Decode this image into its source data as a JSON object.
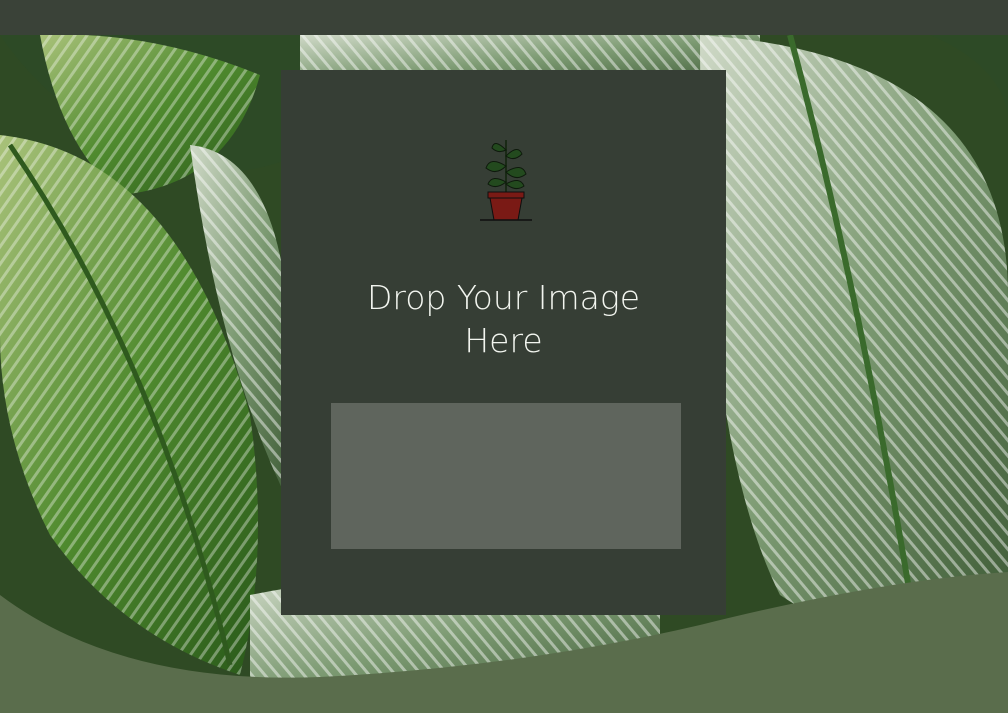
{
  "upload_card": {
    "icon": "potted-plant-icon",
    "prompt_line1": "Drop Your Image",
    "prompt_line2": "Here"
  },
  "background": {
    "description_icon": "tropical-leaves-background"
  },
  "colors": {
    "top_bar": "#3a4238",
    "card": "#363e35",
    "dropzone": "#5f655d",
    "wave": "#5a6d4c",
    "pot": "#7a1a15"
  }
}
